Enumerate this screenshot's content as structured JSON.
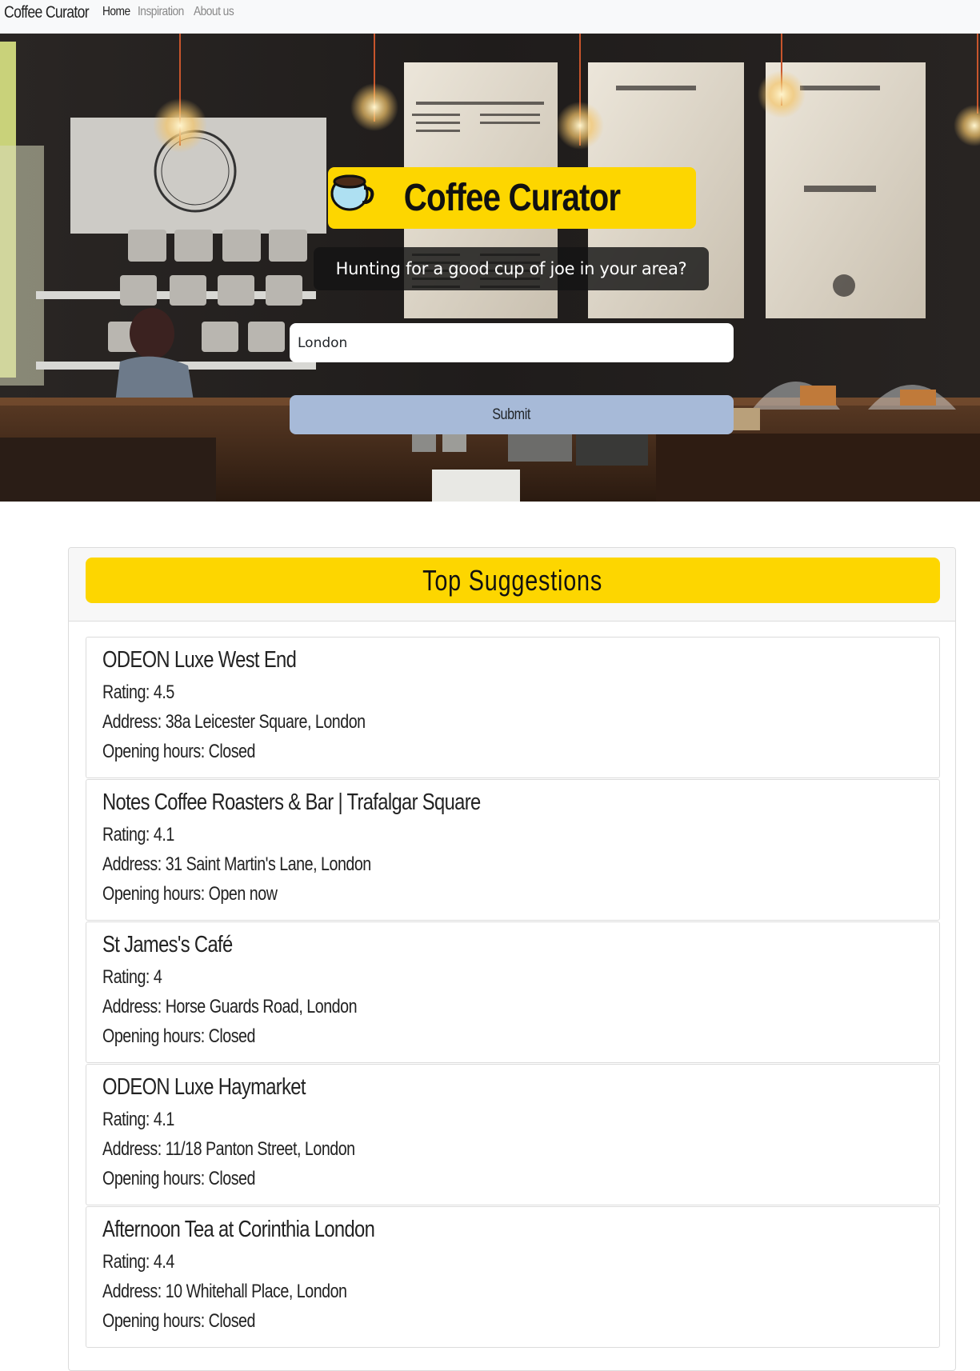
{
  "navbar": {
    "brand": "Coffee Curator",
    "links": [
      {
        "label": "Home",
        "active": true
      },
      {
        "label": "Inspiration",
        "active": false
      },
      {
        "label": "About us",
        "active": false
      }
    ]
  },
  "hero": {
    "background_image": "coffee shop interior with menu boards",
    "title": "Coffee Curator",
    "title_icon": "hot-beverage-icon",
    "subtitle": "Hunting for a good cup of joe in your area?",
    "search": {
      "value": "London",
      "placeholder": ""
    },
    "submit_label": "Submit"
  },
  "suggestions": {
    "header": "Top Suggestions",
    "labels": {
      "rating": "Rating: ",
      "address": "Address: ",
      "hours": "Opening hours: "
    },
    "items": [
      {
        "name": "ODEON Luxe West End",
        "rating": "4.5",
        "address": "38a Leicester Square, London",
        "hours": "Closed"
      },
      {
        "name": "Notes Coffee Roasters & Bar | Trafalgar Square",
        "rating": "4.1",
        "address": "31 Saint Martin's Lane, London",
        "hours": "Open now"
      },
      {
        "name": "St James's Café",
        "rating": "4",
        "address": "Horse Guards Road, London",
        "hours": "Closed"
      },
      {
        "name": "ODEON Luxe Haymarket",
        "rating": "4.1",
        "address": "11/18 Panton Street, London",
        "hours": "Closed"
      },
      {
        "name": "Afternoon Tea at Corinthia London",
        "rating": "4.4",
        "address": "10 Whitehall Place, London",
        "hours": "Closed"
      }
    ]
  },
  "colors": {
    "accent_yellow": "#fdd600",
    "submit_blue": "#a7bad8",
    "navbar_bg": "#f8f9fa"
  }
}
